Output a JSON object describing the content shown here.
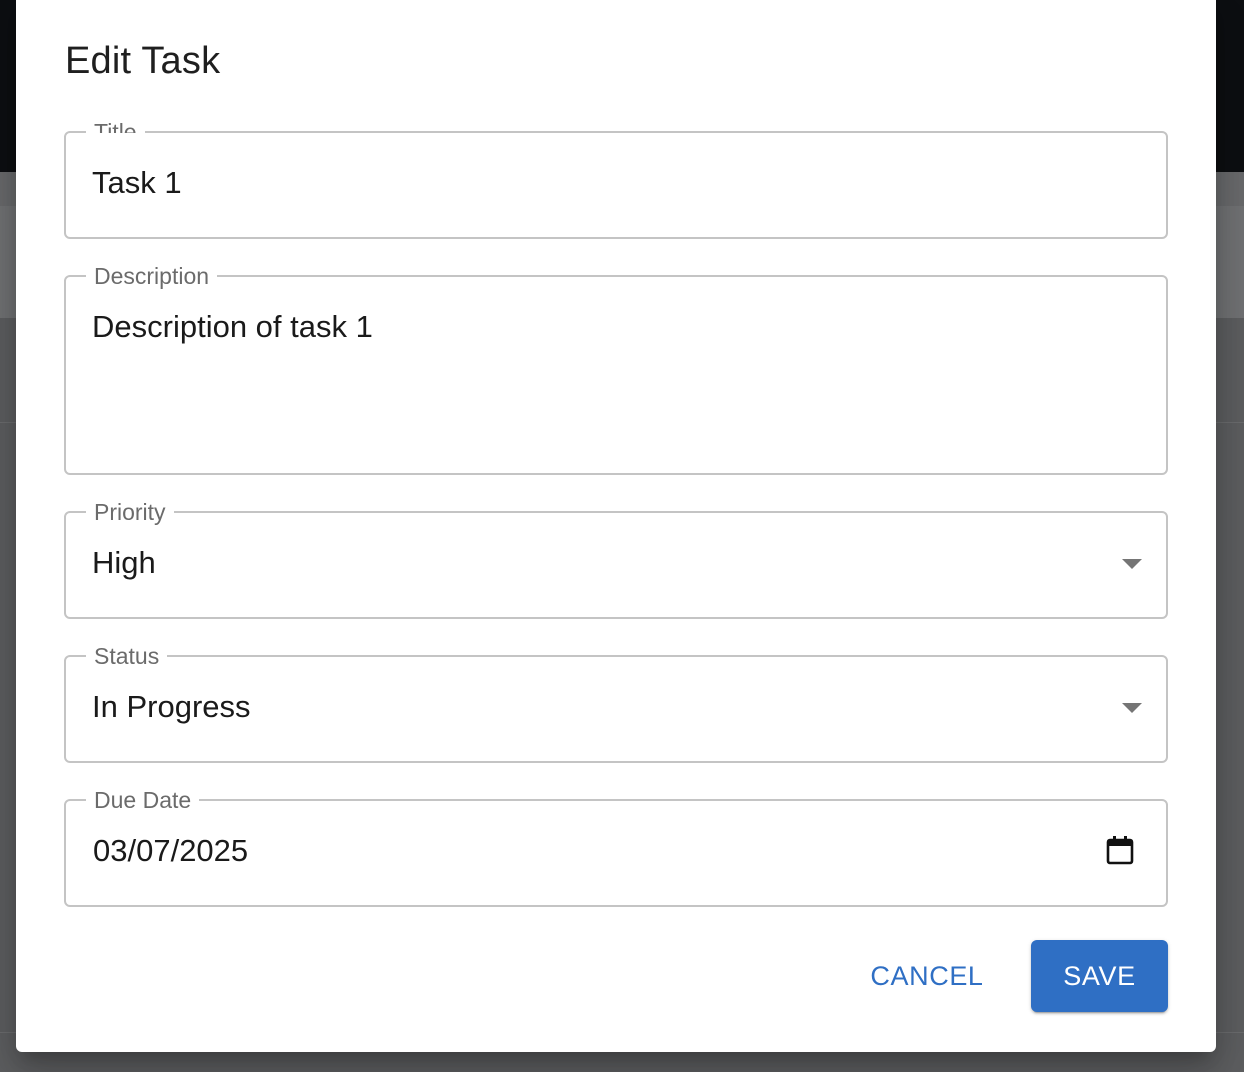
{
  "dialog": {
    "title": "Edit Task"
  },
  "form": {
    "title": {
      "label": "Title",
      "value": "Task 1"
    },
    "description": {
      "label": "Description",
      "value": "Description of task 1"
    },
    "priority": {
      "label": "Priority",
      "value": "High"
    },
    "status": {
      "label": "Status",
      "value": "In Progress"
    },
    "due_date": {
      "label": "Due Date",
      "value": "03/07/2025",
      "icon": "calendar-icon"
    }
  },
  "actions": {
    "cancel_label": "CANCEL",
    "save_label": "SAVE"
  },
  "colors": {
    "accent": "#2f6fc4",
    "backdrop": "#5e5f61",
    "field_border": "#c4c4c4"
  }
}
